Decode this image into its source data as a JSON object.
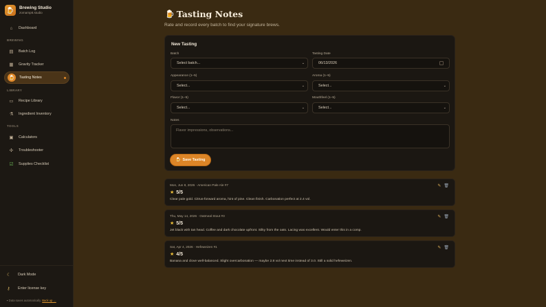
{
  "sidebar": {
    "brand_name": "Brewing Studio",
    "brand_sub": "zomamp8.studio",
    "dashboard": "Dashboard",
    "section_brewing": "BREWING",
    "batch_log": "Batch Log",
    "gravity_tracker": "Gravity Tracker",
    "tasting_notes": "Tasting Notes",
    "section_library": "LIBRARY",
    "recipe_library": "Recipe Library",
    "ingredient_inventory": "Ingredient Inventory",
    "section_tools": "TOOLS",
    "calculators": "Calculators",
    "troubleshooter": "Troubleshooter",
    "supplies_checklist": "Supplies Checklist",
    "dark_mode": "Dark Mode",
    "license": "Enter license key",
    "autosave": "Data saves automatically.",
    "autosave_link": "Back up …"
  },
  "page": {
    "title": "Tasting Notes",
    "subtitle": "Rate and record every batch to find your signature brews."
  },
  "form": {
    "title": "New Tasting",
    "batch_label": "Batch",
    "batch_value": "Select batch...",
    "date_label": "Tasting Date",
    "date_value": "06/13/2026",
    "appearance_label": "Appearance (1–5)",
    "appearance_value": "Select...",
    "aroma_label": "Aroma (1–5)",
    "aroma_value": "Select...",
    "flavor_label": "Flavor (1–5)",
    "flavor_value": "Select...",
    "mouthfeel_label": "Mouthfeel (1–5)",
    "mouthfeel_value": "Select...",
    "notes_label": "Notes",
    "notes_placeholder": "Flavor impressions, observations...",
    "save_label": "Save Tasting"
  },
  "entries": [
    {
      "meta": "Mon, Jun 8, 2026 · American Pale Ale #7",
      "rating": "5/5",
      "note": "Clear pale gold. Citrus-forward aroma, hint of pine. Clean finish. Carbonation perfect at 2.4 vol."
    },
    {
      "meta": "Thu, May 14, 2026 · Oatmeal Stout #3",
      "rating": "5/5",
      "note": "Jet black with tan head. Coffee and dark chocolate upfront. Silky from the oats. Lacing was excellent. Would enter this in a comp."
    },
    {
      "meta": "Sat, Apr 4, 2026 · Hefeweizen #1",
      "rating": "4/5",
      "note": "Banana and clove well-balanced. Slight overcarbonation — maybe 2.8 vol next time instead of 3.0. Still a solid hefeweizen."
    }
  ],
  "colors": {
    "accent": "#dc8527",
    "background": "#3a2a12",
    "panel": "#1b1712",
    "sidebar": "#1c1813",
    "star": "#f0c23a"
  }
}
